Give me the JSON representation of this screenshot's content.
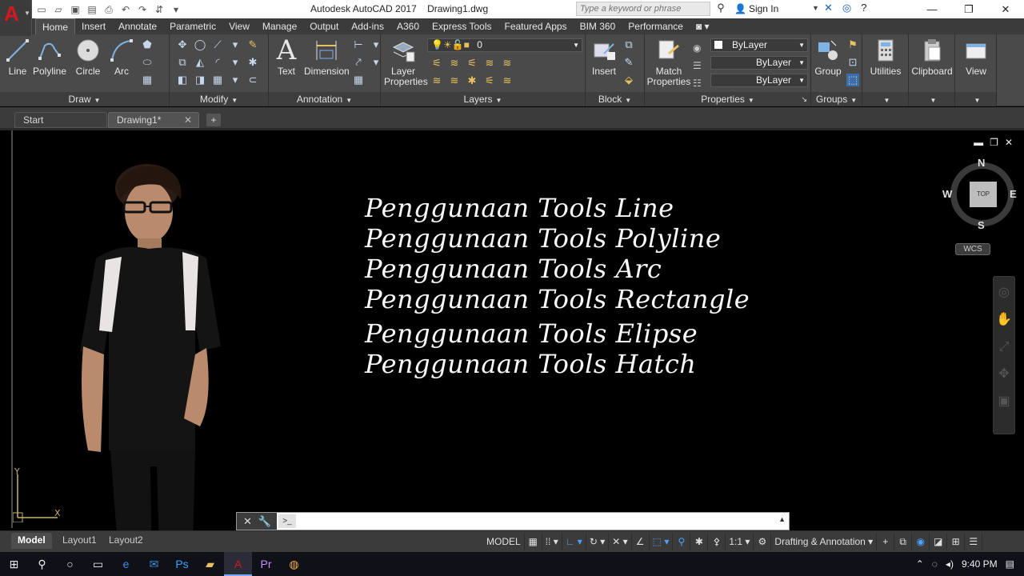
{
  "app": {
    "title": "Autodesk AutoCAD 2017    Drawing1.dwg",
    "logo_letter": "A",
    "search_placeholder": "Type a keyword or phrase",
    "sign_in": "Sign In"
  },
  "ribbon_tabs": [
    "Home",
    "Insert",
    "Annotate",
    "Parametric",
    "View",
    "Manage",
    "Output",
    "Add-ins",
    "A360",
    "Express Tools",
    "Featured Apps",
    "BIM 360",
    "Performance"
  ],
  "ribbon": {
    "draw": {
      "title": "Draw",
      "line": "Line",
      "polyline": "Polyline",
      "circle": "Circle",
      "arc": "Arc"
    },
    "modify": {
      "title": "Modify"
    },
    "annotation": {
      "title": "Annotation",
      "text": "Text",
      "dimension": "Dimension"
    },
    "layers": {
      "title": "Layers",
      "layer_properties_1": "Layer",
      "layer_properties_2": "Properties",
      "current_layer": "0"
    },
    "block": {
      "title": "Block",
      "insert": "Insert"
    },
    "properties": {
      "title": "Properties",
      "match_1": "Match",
      "match_2": "Properties",
      "color": "ByLayer",
      "linetype": "ByLayer",
      "lineweight": "ByLayer"
    },
    "groups": {
      "title": "Groups",
      "group": "Group"
    },
    "utilities": "Utilities",
    "clipboard": "Clipboard",
    "view": "View"
  },
  "file_tabs": {
    "start": "Start",
    "drawing": "Drawing1*"
  },
  "drawing_text": [
    "Penggunaan Tools Line",
    "Penggunaan Tools Polyline",
    "Penggunaan Tools Arc",
    "Penggunaan Tools Rectangle",
    "Penggunaan Tools Elipse",
    "Penggunaan Tools Hatch"
  ],
  "viewcube": {
    "n": "N",
    "s": "S",
    "e": "E",
    "w": "W",
    "face": "TOP",
    "wcs": "WCS"
  },
  "layout_tabs": {
    "model": "Model",
    "layout1": "Layout1",
    "layout2": "Layout2"
  },
  "status": {
    "model": "MODEL",
    "scale": "1:1",
    "workspace": "Drafting & Annotation"
  },
  "taskbar": {
    "time": "9:40 PM"
  },
  "colors": {
    "accent_red": "#d4181f",
    "ribbon_bg": "#4a4a4a",
    "canvas_bg": "#000000"
  }
}
